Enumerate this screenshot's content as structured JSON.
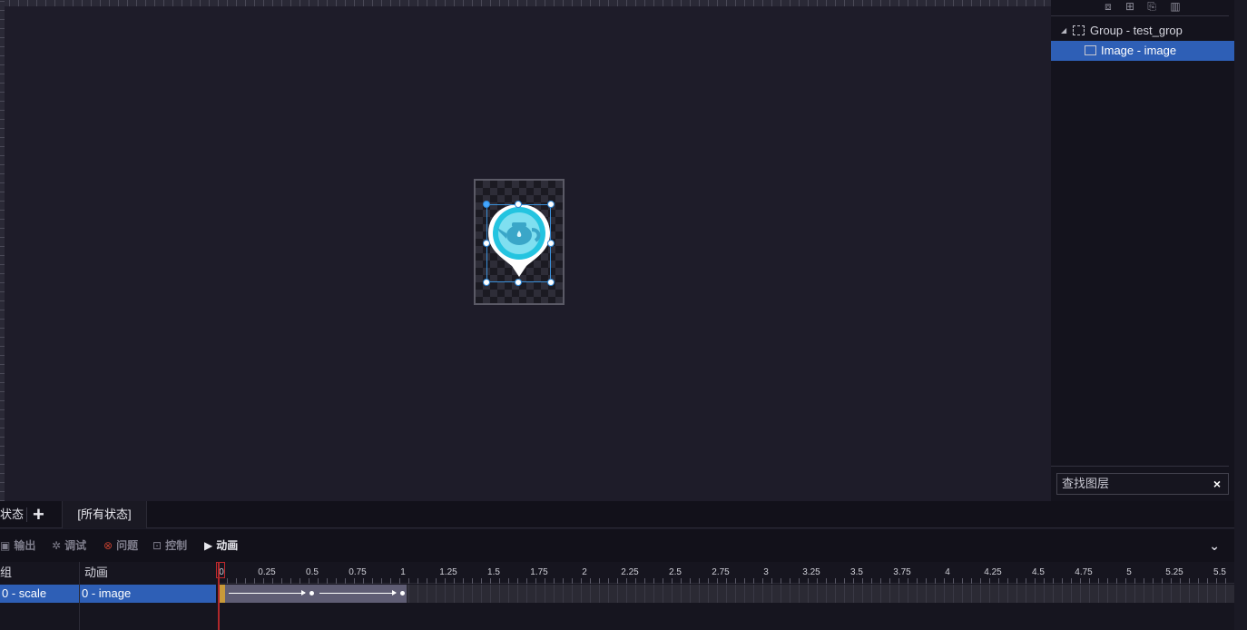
{
  "layers_panel": {
    "toolbar": [
      "align-icon",
      "layer-order-icon",
      "copy-icon",
      "delete-icon"
    ],
    "items": [
      {
        "label": "Group - test_grop",
        "type": "group",
        "expanded": true
      },
      {
        "label": "Image - image",
        "type": "image",
        "selected": true
      }
    ],
    "search_placeholder": "查找图层",
    "search_clear": "×"
  },
  "state_bar": {
    "current_state": "状态",
    "add": "+",
    "all_states": "[所有状态]"
  },
  "console_tabs": [
    {
      "label": "输出",
      "icon": "output-icon"
    },
    {
      "label": "调试",
      "icon": "bug-icon"
    },
    {
      "label": "问题",
      "icon": "error-icon"
    },
    {
      "label": "控制",
      "icon": "terminal-icon"
    },
    {
      "label": "动画",
      "icon": "animation-icon",
      "active": true
    }
  ],
  "collapse": "⌄",
  "timeline": {
    "col_a_header": "组",
    "col_b_header": "动画",
    "row_a": "0 - scale",
    "row_b": "0 - image",
    "ticks": [
      "0",
      "0.25",
      "0.5",
      "0.75",
      "1",
      "1.25",
      "1.5",
      "1.75",
      "2",
      "2.25",
      "2.5",
      "2.75",
      "3",
      "3.25",
      "3.5",
      "3.75",
      "4",
      "4.25",
      "4.5",
      "4.75",
      "5",
      "5.25",
      "5.5"
    ],
    "playhead_time": 0,
    "clip": {
      "start": 0,
      "end": 1.0,
      "keyframes": [
        0,
        0.5,
        1.0
      ]
    }
  },
  "colors": {
    "selection": "#2e5fb6",
    "playhead": "#b0282b",
    "canvas_bg": "#1e1c29"
  }
}
